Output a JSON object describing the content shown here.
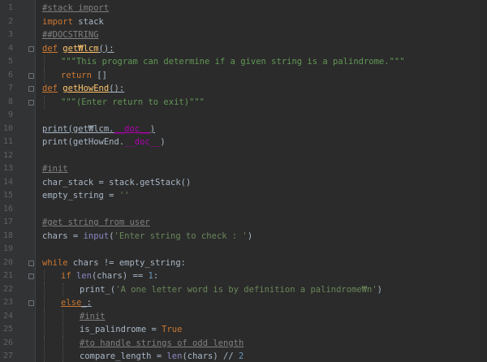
{
  "editor": {
    "lines": [
      {
        "n": "1",
        "indent": 0,
        "tokens": [
          {
            "t": "#stack import",
            "k": "comment"
          }
        ]
      },
      {
        "n": "2",
        "indent": 0,
        "tokens": [
          {
            "t": "import",
            "k": "keyword"
          },
          {
            "t": " stack",
            "k": "plain"
          }
        ]
      },
      {
        "n": "3",
        "indent": 0,
        "tokens": [
          {
            "t": "##DOCSTRING",
            "k": "comment"
          }
        ]
      },
      {
        "n": "4",
        "indent": 0,
        "fold": true,
        "tokens": [
          {
            "t": "def",
            "k": "def"
          },
          {
            "t": " ",
            "k": "plain"
          },
          {
            "t": "get₩lcm",
            "k": "defname"
          },
          {
            "t": "():",
            "k": "plain",
            "u": true
          }
        ]
      },
      {
        "n": "5",
        "indent": 1,
        "tokens": [
          {
            "t": "\"\"\"This program can determine if a given string is a palindrome.\"\"\"",
            "k": "doc"
          }
        ]
      },
      {
        "n": "6",
        "indent": 1,
        "fold": true,
        "tokens": [
          {
            "t": "return",
            "k": "keyword"
          },
          {
            "t": " []",
            "k": "plain"
          }
        ]
      },
      {
        "n": "7",
        "indent": 0,
        "fold": true,
        "tokens": [
          {
            "t": "def",
            "k": "def"
          },
          {
            "t": " ",
            "k": "plain"
          },
          {
            "t": "getHowEnd",
            "k": "defname"
          },
          {
            "t": "():",
            "k": "plain",
            "u": true
          }
        ]
      },
      {
        "n": "8",
        "indent": 1,
        "fold": true,
        "tokens": [
          {
            "t": "\"\"\"(Enter return to exit)\"\"\"",
            "k": "doc"
          }
        ]
      },
      {
        "n": "9",
        "indent": 0,
        "tokens": []
      },
      {
        "n": "10",
        "indent": 0,
        "tokens": [
          {
            "t": "print(get₩lcm.",
            "k": "plain",
            "u": true
          },
          {
            "t": "__doc__",
            "k": "dunder",
            "u": true
          },
          {
            "t": ")",
            "k": "plain",
            "u": true
          }
        ]
      },
      {
        "n": "11",
        "indent": 0,
        "tokens": [
          {
            "t": "print(getHowEnd.",
            "k": "plain"
          },
          {
            "t": "__doc__",
            "k": "dunder"
          },
          {
            "t": ")",
            "k": "plain"
          }
        ]
      },
      {
        "n": "12",
        "indent": 0,
        "tokens": []
      },
      {
        "n": "13",
        "indent": 0,
        "tokens": [
          {
            "t": "#init",
            "k": "comment"
          }
        ]
      },
      {
        "n": "14",
        "indent": 0,
        "tokens": [
          {
            "t": "char_stack = stack.getStack()",
            "k": "plain"
          }
        ]
      },
      {
        "n": "15",
        "indent": 0,
        "tokens": [
          {
            "t": "empty_string = ",
            "k": "plain"
          },
          {
            "t": "''",
            "k": "str"
          }
        ]
      },
      {
        "n": "16",
        "indent": 0,
        "tokens": []
      },
      {
        "n": "17",
        "indent": 0,
        "tokens": [
          {
            "t": "#get string from user",
            "k": "comment"
          }
        ]
      },
      {
        "n": "18",
        "indent": 0,
        "tokens": [
          {
            "t": "chars = ",
            "k": "plain"
          },
          {
            "t": "input",
            "k": "builtin"
          },
          {
            "t": "(",
            "k": "plain"
          },
          {
            "t": "'Enter string to check : '",
            "k": "str"
          },
          {
            "t": ")",
            "k": "plain"
          }
        ]
      },
      {
        "n": "19",
        "indent": 0,
        "tokens": []
      },
      {
        "n": "20",
        "indent": 0,
        "fold": true,
        "tokens": [
          {
            "t": "while",
            "k": "keyword"
          },
          {
            "t": " chars != empty_string:",
            "k": "plain"
          }
        ]
      },
      {
        "n": "21",
        "indent": 1,
        "fold": true,
        "tokens": [
          {
            "t": "if",
            "k": "keyword"
          },
          {
            "t": " ",
            "k": "plain"
          },
          {
            "t": "len",
            "k": "builtin"
          },
          {
            "t": "(chars) == ",
            "k": "plain"
          },
          {
            "t": "1",
            "k": "num"
          },
          {
            "t": ":",
            "k": "plain"
          }
        ]
      },
      {
        "n": "22",
        "indent": 2,
        "tokens": [
          {
            "t": "print_(",
            "k": "plain"
          },
          {
            "t": "'A one letter word is by definition a palindrome₩n'",
            "k": "str"
          },
          {
            "t": ")",
            "k": "plain"
          }
        ]
      },
      {
        "n": "23",
        "indent": 1,
        "fold": true,
        "tokens": [
          {
            "t": "else",
            "k": "keyword",
            "u": true
          },
          {
            "t": "_:",
            "k": "plain",
            "u": true
          }
        ]
      },
      {
        "n": "24",
        "indent": 2,
        "tokens": [
          {
            "t": "#init",
            "k": "comment"
          }
        ]
      },
      {
        "n": "25",
        "indent": 2,
        "tokens": [
          {
            "t": "is_palindrome = ",
            "k": "plain"
          },
          {
            "t": "True",
            "k": "keyword"
          }
        ]
      },
      {
        "n": "26",
        "indent": 2,
        "tokens": [
          {
            "t": "#to handle strings of odd length",
            "k": "comment"
          }
        ]
      },
      {
        "n": "27",
        "indent": 2,
        "tokens": [
          {
            "t": "compare_length = ",
            "k": "plain"
          },
          {
            "t": "len",
            "k": "builtin"
          },
          {
            "t": "(chars) // ",
            "k": "plain"
          },
          {
            "t": "2",
            "k": "num"
          }
        ]
      }
    ]
  }
}
